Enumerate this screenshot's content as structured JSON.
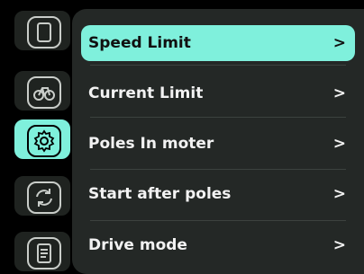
{
  "rail": {
    "items": [
      {
        "icon": "tablet-icon",
        "active": false
      },
      {
        "icon": "bicycle-icon",
        "active": false
      },
      {
        "icon": "gear-icon",
        "active": true
      },
      {
        "icon": "refresh-icon",
        "active": false
      },
      {
        "icon": "document-icon",
        "active": false
      }
    ]
  },
  "menu": {
    "items": [
      {
        "label": "Speed Limit",
        "chevron": ">"
      },
      {
        "label": "Current Limit",
        "chevron": ">"
      },
      {
        "label": "Poles In moter",
        "chevron": ">"
      },
      {
        "label": "Start after poles",
        "chevron": ">"
      },
      {
        "label": "Drive mode",
        "chevron": ">"
      }
    ],
    "selected_index": 0
  },
  "colors": {
    "accent": "#7ff0dc",
    "panel": "#242826",
    "background": "#000000",
    "text": "#f2f2f2"
  }
}
